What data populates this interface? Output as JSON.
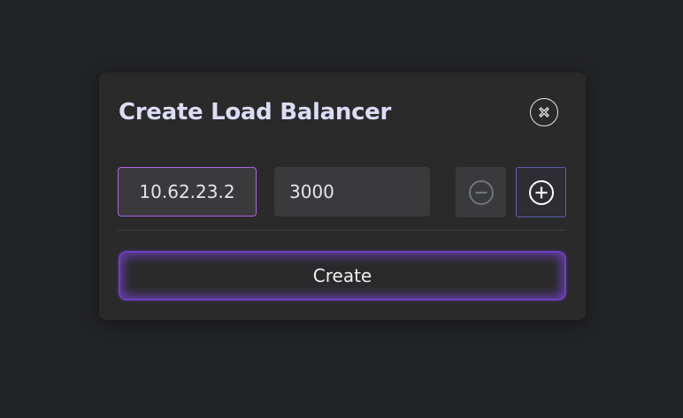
{
  "dialog": {
    "title": "Create Load Balancer",
    "close_icon": "close-circle-icon",
    "ip_field": {
      "value": "10.62.23.2"
    },
    "port_field": {
      "value": "3000"
    },
    "decrement_icon": "minus-circle-icon",
    "increment_icon": "plus-circle-icon",
    "create_label": "Create"
  },
  "colors": {
    "background": "#222326",
    "dialog_bg": "#2a2a2b",
    "accent_purple": "#a866e6",
    "create_glow": "#6f3fc4",
    "plus_border": "#5b5fb0"
  }
}
